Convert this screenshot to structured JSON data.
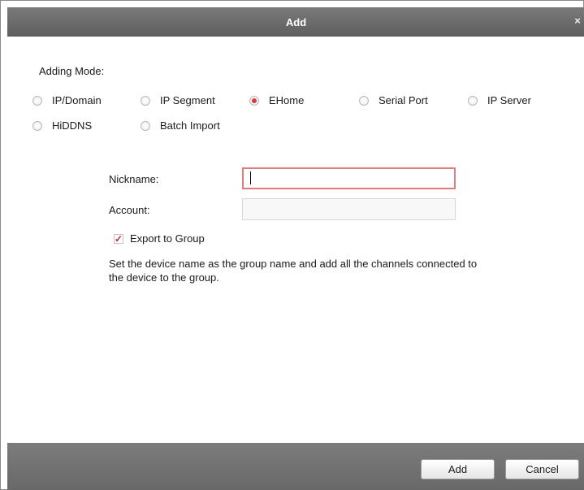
{
  "window": {
    "title": "Add",
    "close_glyph": "×"
  },
  "adding_mode": {
    "label": "Adding Mode:",
    "options": [
      {
        "label": "IP/Domain",
        "checked": false
      },
      {
        "label": "IP Segment",
        "checked": false
      },
      {
        "label": "EHome",
        "checked": true
      },
      {
        "label": "Serial Port",
        "checked": false
      },
      {
        "label": "IP Server",
        "checked": false
      },
      {
        "label": "HiDDNS",
        "checked": false
      },
      {
        "label": "Batch Import",
        "checked": false
      }
    ]
  },
  "form": {
    "nickname": {
      "label": "Nickname:",
      "value": ""
    },
    "account": {
      "label": "Account:",
      "value": ""
    },
    "export_to_group": {
      "label": "Export to Group",
      "checked": true,
      "check_glyph": "✓"
    },
    "hint": "Set the device name as the group name and add all the channels connected to the device to the group."
  },
  "footer": {
    "add_label": "Add",
    "cancel_label": "Cancel"
  },
  "colors": {
    "accent": "#d63b3b",
    "titlebar": "#6b6b6b",
    "footer": "#727272"
  }
}
